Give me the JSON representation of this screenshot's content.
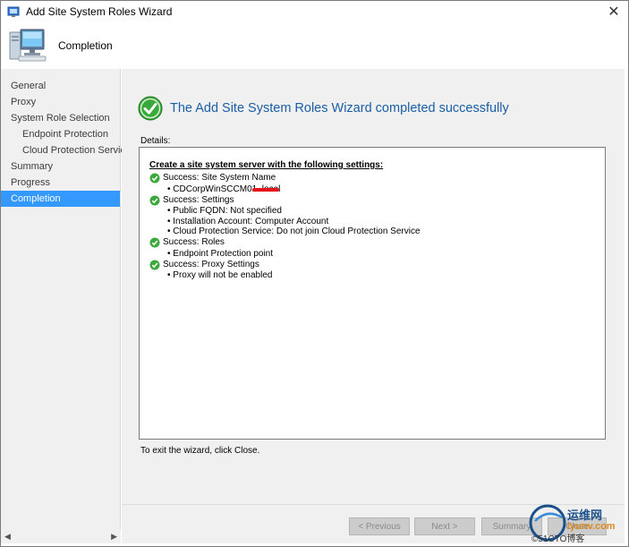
{
  "window": {
    "title": "Add Site System Roles Wizard"
  },
  "header": {
    "title": "Completion",
    "icon": "computer-icon"
  },
  "nav": {
    "items": [
      {
        "label": "General",
        "sub": false,
        "active": false
      },
      {
        "label": "Proxy",
        "sub": false,
        "active": false
      },
      {
        "label": "System Role Selection",
        "sub": false,
        "active": false
      },
      {
        "label": "Endpoint Protection",
        "sub": true,
        "active": false
      },
      {
        "label": "Cloud Protection Service",
        "sub": true,
        "active": false
      },
      {
        "label": "Summary",
        "sub": false,
        "active": false
      },
      {
        "label": "Progress",
        "sub": false,
        "active": false
      },
      {
        "label": "Completion",
        "sub": false,
        "active": true
      }
    ]
  },
  "main": {
    "success_title": "The Add Site System Roles Wizard completed successfully",
    "details_label": "Details:",
    "details": {
      "heading": "Create a site system server with the following settings:",
      "sections": [
        {
          "title": "Success: Site System Name",
          "bullets": [
            "CDCorpWinSCCM01.                    local"
          ]
        },
        {
          "title": "Success: Settings",
          "bullets": [
            "Public FQDN: Not specified",
            "Installation Account: Computer Account",
            "Cloud Protection Service: Do not join Cloud Protection Service"
          ]
        },
        {
          "title": "Success: Roles",
          "bullets": [
            "Endpoint Protection point"
          ]
        },
        {
          "title": "Success: Proxy Settings",
          "bullets": [
            "Proxy will not be enabled"
          ]
        }
      ]
    },
    "exit_text": "To exit the wizard, click Close."
  },
  "buttons": {
    "previous": "< Previous",
    "next": "Next >",
    "summary": "Summary",
    "close": "Close"
  },
  "watermark": {
    "line1": "运维网",
    "line2": "iyunv.com",
    "line3": "©51CTO博客"
  },
  "colors": {
    "accent": "#3399ff",
    "title_blue": "#1a5ea6",
    "success_green": "#3aa83a"
  }
}
